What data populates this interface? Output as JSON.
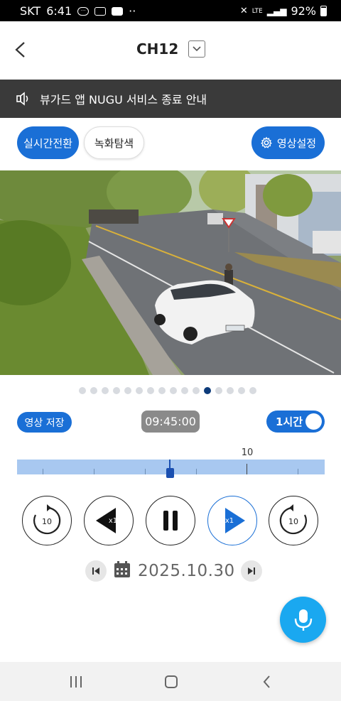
{
  "status_bar": {
    "carrier": "SKT",
    "time": "6:41",
    "battery": "92%",
    "network": "LTE"
  },
  "header": {
    "title": "CH12"
  },
  "notice": {
    "text": "뷰가드 앱 NUGU 서비스 종료 안내"
  },
  "buttons": {
    "live": "실시간전환",
    "recording_search": "녹화탐색",
    "video_settings": "영상설정"
  },
  "video": {
    "plate": "000 0000"
  },
  "pager": {
    "count": 16,
    "active_index": 11
  },
  "controls": {
    "save": "영상 저장",
    "time": "09:45:00",
    "range": "1시간"
  },
  "timeline": {
    "marker_label": "10",
    "cursor_fraction": 0.497
  },
  "playback": {
    "rewind": "10",
    "slow": "x1",
    "fast": "x1",
    "forward": "10"
  },
  "date": {
    "value": "2025.10.30"
  },
  "colors": {
    "accent": "#1a6fd6",
    "notice_bg": "#3a3a3a",
    "timeline": "#a8c8f0",
    "mic": "#1aa8f0"
  }
}
